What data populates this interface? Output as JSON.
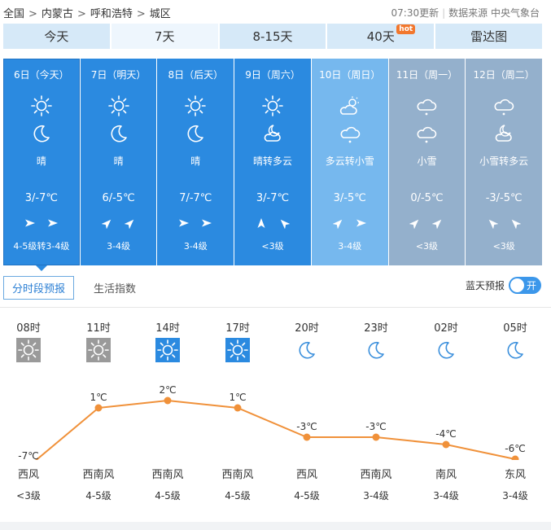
{
  "breadcrumb": [
    {
      "label": "全国"
    },
    {
      "label": "内蒙古"
    },
    {
      "label": "呼和浩特"
    },
    {
      "label": "城区"
    }
  ],
  "update_time": "07:30更新",
  "source": "数据来源 中央气象台",
  "tabs": [
    {
      "label": "今天"
    },
    {
      "label": "7天"
    },
    {
      "label": "8-15天"
    },
    {
      "label": "40天",
      "badge": "hot"
    },
    {
      "label": "雷达图"
    }
  ],
  "days": [
    {
      "title": "6日（今天）",
      "cond": "晴",
      "temp": "3/-7℃",
      "wind_level": "4-5级转3-4级",
      "icon1": "sun-icon",
      "icon2": "moon-icon",
      "bg": "#2b8ae0",
      "wind_dirs": [
        "east",
        "east"
      ]
    },
    {
      "title": "7日（明天）",
      "cond": "晴",
      "temp": "6/-5℃",
      "wind_level": "3-4级",
      "icon1": "sun-icon",
      "icon2": "moon-icon",
      "bg": "#2b8ae0",
      "wind_dirs": [
        "northeast",
        "northeast"
      ]
    },
    {
      "title": "8日（后天）",
      "cond": "晴",
      "temp": "7/-7℃",
      "wind_level": "3-4级",
      "icon1": "sun-icon",
      "icon2": "moon-icon",
      "bg": "#2b8ae0",
      "wind_dirs": [
        "east",
        "east"
      ]
    },
    {
      "title": "9日（周六）",
      "cond": "晴转多云",
      "temp": "3/-7℃",
      "wind_level": "<3级",
      "icon1": "sun-icon",
      "icon2": "cloud-moon-icon",
      "bg": "#2b8ae0",
      "wind_dirs": [
        "north",
        "northwest"
      ]
    },
    {
      "title": "10日（周日）",
      "cond": "多云转小雪",
      "temp": "3/-5℃",
      "wind_level": "3-4级",
      "icon1": "cloud-sun-icon",
      "icon2": "snow-cloud-icon",
      "bg": "#76b8ee",
      "wind_dirs": [
        "northeast",
        "east"
      ]
    },
    {
      "title": "11日（周一）",
      "cond": "小雪",
      "temp": "0/-5℃",
      "wind_level": "<3级",
      "icon1": "snow-cloud-icon",
      "icon2": "snow-cloud-icon",
      "bg": "#94b0cc",
      "wind_dirs": [
        "northeast",
        "northeast"
      ]
    },
    {
      "title": "12日（周二）",
      "cond": "小雪转多云",
      "temp": "-3/-5℃",
      "wind_level": "<3级",
      "icon1": "snow-cloud-icon",
      "icon2": "cloud-moon-icon",
      "bg": "#94b0cc",
      "wind_dirs": [
        "northwest",
        "northwest"
      ]
    }
  ],
  "subtabs": [
    {
      "label": "分时段预报"
    },
    {
      "label": "生活指数"
    }
  ],
  "blue_sky": {
    "label": "蓝天预报",
    "toggle": "开"
  },
  "hours": [
    {
      "time": "08时",
      "icon": "sun-icon",
      "icon_bg": "#9a9a9a",
      "temp": "-7℃",
      "wind": "西风",
      "level": "<3级"
    },
    {
      "time": "11时",
      "icon": "sun-icon",
      "icon_bg": "#9a9a9a",
      "temp": "1℃",
      "wind": "西南风",
      "level": "4-5级"
    },
    {
      "time": "14时",
      "icon": "sun-icon",
      "icon_bg": "#2b8ae0",
      "temp": "2℃",
      "wind": "西南风",
      "level": "4-5级"
    },
    {
      "time": "17时",
      "icon": "sun-icon",
      "icon_bg": "#2b8ae0",
      "temp": "1℃",
      "wind": "西南风",
      "level": "4-5级"
    },
    {
      "time": "20时",
      "icon": "moon-icon",
      "icon_bg": "",
      "temp": "-3℃",
      "wind": "西风",
      "level": "4-5级"
    },
    {
      "time": "23时",
      "icon": "moon-icon",
      "icon_bg": "",
      "temp": "-3℃",
      "wind": "西南风",
      "level": "3-4级"
    },
    {
      "time": "02时",
      "icon": "moon-icon",
      "icon_bg": "",
      "temp": "-4℃",
      "wind": "南风",
      "level": "3-4级"
    },
    {
      "time": "05时",
      "icon": "moon-icon",
      "icon_bg": "",
      "temp": "-6℃",
      "wind": "东风",
      "level": "3-4级"
    }
  ],
  "chart_data": {
    "type": "line",
    "categories": [
      "08时",
      "11时",
      "14时",
      "17时",
      "20时",
      "23时",
      "02时",
      "05时"
    ],
    "values": [
      -7,
      1,
      2,
      1,
      -3,
      -3,
      -4,
      -6
    ],
    "data_labels": [
      "-7℃",
      "1℃",
      "2℃",
      "1℃",
      "-3℃",
      "-3℃",
      "-4℃",
      "-6℃"
    ],
    "line_color": "#f0913a"
  },
  "colors": {
    "accent": "#2b8ae0",
    "line": "#f0913a",
    "tab_bg": "#d6e9f8"
  }
}
